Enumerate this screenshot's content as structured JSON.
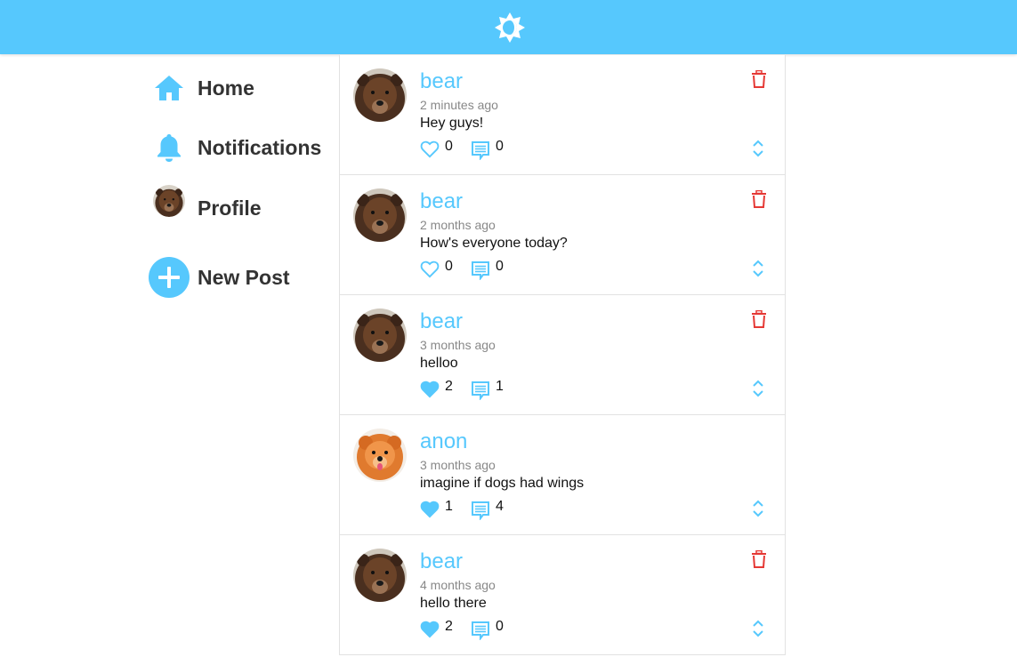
{
  "header": {
    "theme_icon": "theme-toggle-icon",
    "color": "#56c8fd"
  },
  "sidebar": {
    "items": [
      {
        "label": "Home",
        "icon": "home-icon"
      },
      {
        "label": "Notifications",
        "icon": "bell-icon"
      },
      {
        "label": "Profile",
        "icon": "avatar-bear"
      },
      {
        "label": "New Post",
        "icon": "plus-circle-icon"
      }
    ]
  },
  "posts": [
    {
      "author": "bear",
      "time": "2 minutes ago",
      "body": "Hey guys!",
      "likes": "0",
      "liked": false,
      "comments": "0",
      "avatar": "bear",
      "deletable": true
    },
    {
      "author": "bear",
      "time": "2 months ago",
      "body": "How's everyone today?",
      "likes": "0",
      "liked": false,
      "comments": "0",
      "avatar": "bear",
      "deletable": true
    },
    {
      "author": "bear",
      "time": "3 months ago",
      "body": "helloo",
      "likes": "2",
      "liked": true,
      "comments": "1",
      "avatar": "bear",
      "deletable": true
    },
    {
      "author": "anon",
      "time": "3 months ago",
      "body": "imagine if dogs had wings",
      "likes": "1",
      "liked": true,
      "comments": "4",
      "avatar": "dog",
      "deletable": false
    },
    {
      "author": "bear",
      "time": "4 months ago",
      "body": "hello there",
      "likes": "2",
      "liked": true,
      "comments": "0",
      "avatar": "bear",
      "deletable": true
    }
  ],
  "colors": {
    "accent": "#56c8fd",
    "delete": "#e53935",
    "text": "#333333",
    "muted": "#888888"
  }
}
